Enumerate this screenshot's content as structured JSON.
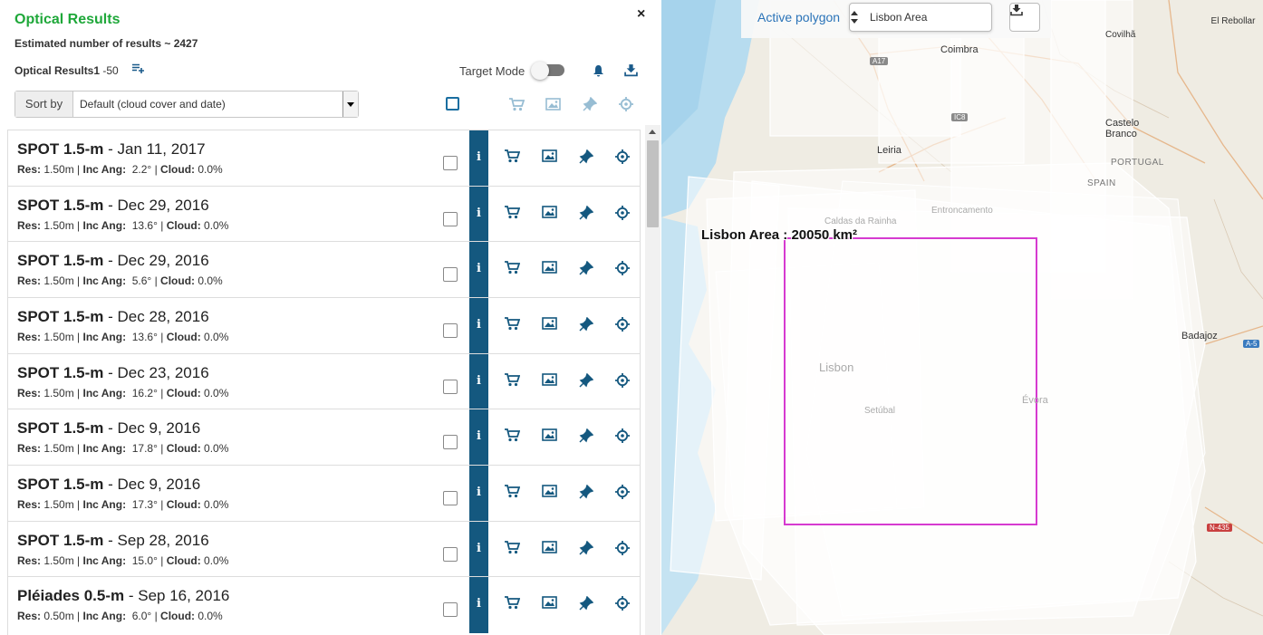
{
  "panel": {
    "title": "Optical Results",
    "close": "×",
    "estimate": "Estimated number of results ~ 2427",
    "results_label": "Optical Results1",
    "results_range": " -50",
    "target_mode": "Target Mode",
    "target_mode_on": false,
    "sort_label": "Sort by",
    "sort_value": "Default (cloud cover and date)"
  },
  "results": [
    {
      "sensor": "SPOT 1.5-m",
      "date": " - Jan 11, 2017",
      "res": "1.50m",
      "inc": "2.2°",
      "cloud": "0.0%"
    },
    {
      "sensor": "SPOT 1.5-m",
      "date": " - Dec 29, 2016",
      "res": "1.50m",
      "inc": "13.6°",
      "cloud": "0.0%"
    },
    {
      "sensor": "SPOT 1.5-m",
      "date": " - Dec 29, 2016",
      "res": "1.50m",
      "inc": "5.6°",
      "cloud": "0.0%"
    },
    {
      "sensor": "SPOT 1.5-m",
      "date": " - Dec 28, 2016",
      "res": "1.50m",
      "inc": "13.6°",
      "cloud": "0.0%"
    },
    {
      "sensor": "SPOT 1.5-m",
      "date": " - Dec 23, 2016",
      "res": "1.50m",
      "inc": "16.2°",
      "cloud": "0.0%"
    },
    {
      "sensor": "SPOT 1.5-m",
      "date": " - Dec 9, 2016",
      "res": "1.50m",
      "inc": "17.8°",
      "cloud": "0.0%"
    },
    {
      "sensor": "SPOT 1.5-m",
      "date": " - Dec 9, 2016",
      "res": "1.50m",
      "inc": "17.3°",
      "cloud": "0.0%"
    },
    {
      "sensor": "SPOT 1.5-m",
      "date": " - Sep 28, 2016",
      "res": "1.50m",
      "inc": "15.0°",
      "cloud": "0.0%"
    },
    {
      "sensor": "Pléiades 0.5-m",
      "date": " - Sep 16, 2016",
      "res": "0.50m",
      "inc": "6.0°",
      "cloud": "0.0%"
    }
  ],
  "row_labels": {
    "res": "Res:",
    "inc": "Inc Ang:",
    "cloud": "Cloud:",
    "sep": " | ",
    "info": "i"
  },
  "row_icons": [
    "cart-icon",
    "image-icon",
    "pin-icon",
    "crosshair-icon"
  ],
  "map": {
    "active_polygon_label": "Active polygon",
    "polygon_value": "Lisbon Area",
    "polygon_label": "Lisbon Area : 20050 km²",
    "places": [
      "Coimbra",
      "Covilhã",
      "El Rebollar",
      "Castelo Branco",
      "Leiria",
      "PORTUGAL",
      "SPAIN",
      "Caldas da Rainha",
      "Entroncamento",
      "Lisbon",
      "Setúbal",
      "Évora",
      "Badajoz"
    ],
    "shields": [
      "A17",
      "IC8",
      "A-5",
      "N-435"
    ]
  },
  "colors": {
    "accent_green": "#1fa83a",
    "icon_blue": "#14587f",
    "polygon": "#d63ad0",
    "water": "#b7dcef"
  }
}
